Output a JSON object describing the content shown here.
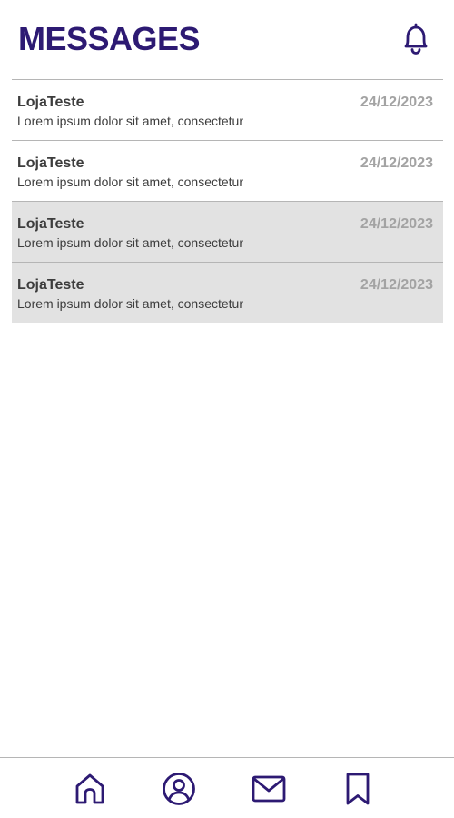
{
  "header": {
    "title": "MESSAGES",
    "notification_icon": "bell-icon"
  },
  "messages": [
    {
      "sender": "LojaTeste",
      "preview": "Lorem ipsum dolor sit amet, consectetur",
      "date": "24/12/2023",
      "read": false
    },
    {
      "sender": "LojaTeste",
      "preview": "Lorem ipsum dolor sit amet, consectetur",
      "date": "24/12/2023",
      "read": false
    },
    {
      "sender": "LojaTeste",
      "preview": "Lorem ipsum dolor sit amet, consectetur",
      "date": "24/12/2023",
      "read": true
    },
    {
      "sender": "LojaTeste",
      "preview": "Lorem ipsum dolor sit amet, consectetur",
      "date": "24/12/2023",
      "read": true
    }
  ],
  "bottom_nav": {
    "items": [
      "home-icon",
      "profile-icon",
      "mail-icon",
      "bookmark-icon"
    ]
  },
  "colors": {
    "accent": "#2d1a73",
    "text": "#3d3d3d",
    "date": "#a3a3a3",
    "read_row_bg": "#e2e2e2",
    "divider": "#b5b5b5"
  }
}
